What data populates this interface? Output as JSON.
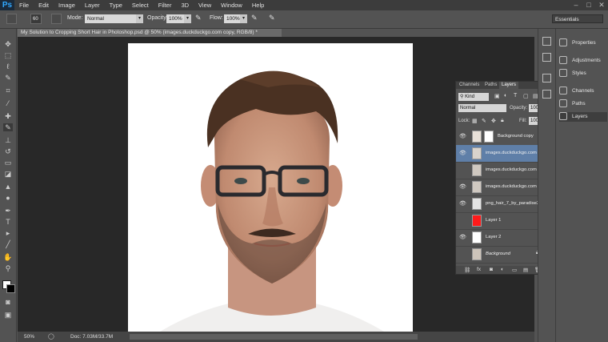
{
  "menu": {
    "logo": "Ps",
    "items": [
      "File",
      "Edit",
      "Image",
      "Layer",
      "Type",
      "Select",
      "Filter",
      "3D",
      "View",
      "Window",
      "Help"
    ]
  },
  "options": {
    "brush_size": "60",
    "mode_label": "Mode:",
    "mode_value": "Normal",
    "opacity_label": "Opacity:",
    "opacity_value": "100%",
    "flow_label": "Flow:",
    "flow_value": "100%",
    "workspace": "Essentials"
  },
  "document": {
    "tab_title": "My Solution to Cropping Short Hair in Photoshop.psd @ 50% (images.duckduckgo.com copy, RGB/8) *"
  },
  "status": {
    "zoom": "50%",
    "doc_info": "Doc: 7.03M/33.7M"
  },
  "layers_panel": {
    "tabs": [
      "Channels",
      "Paths",
      "Layers"
    ],
    "filter_kind": "Kind",
    "blend_mode": "Normal",
    "opacity_label": "Opacity:",
    "opacity_value": "100%",
    "lock_label": "Lock:",
    "fill_label": "Fill:",
    "fill_value": "100%",
    "layers": [
      {
        "name": "Background copy",
        "visible": true,
        "selected": false,
        "thumb": "#e8e0d8"
      },
      {
        "name": "images.duckduckgo.com c...",
        "visible": true,
        "selected": true,
        "thumb": "#d9d3cc"
      },
      {
        "name": "images.duckduckgo.com",
        "visible": false,
        "selected": false,
        "thumb": "#cfc8c0"
      },
      {
        "name": "images.duckduckgo.com",
        "visible": true,
        "selected": false,
        "thumb": "#cfc8c0"
      },
      {
        "name": "png_hair_7_by_paradise2...",
        "visible": true,
        "selected": false,
        "thumb": "#e4e4e4"
      },
      {
        "name": "Layer 1",
        "visible": false,
        "selected": false,
        "thumb": "#ff1a1a"
      },
      {
        "name": "Layer 2",
        "visible": true,
        "selected": false,
        "thumb": "#ffffff"
      },
      {
        "name": "Background",
        "visible": false,
        "selected": false,
        "thumb": "#cdc4ba"
      }
    ]
  },
  "dock": {
    "items": [
      "Properties",
      "Adjustments",
      "Styles",
      "Channels",
      "Paths",
      "Layers"
    ]
  },
  "colors": {
    "accent": "#5f7fa8",
    "menubar": "#3c3c3c",
    "panel": "#535353",
    "canvas_bg": "#282828"
  }
}
